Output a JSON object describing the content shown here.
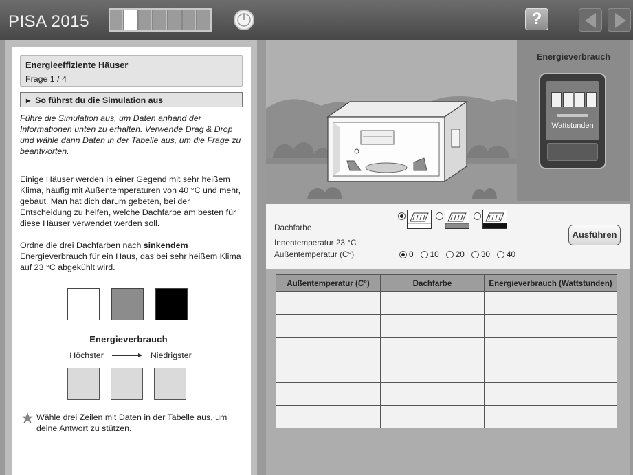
{
  "app": {
    "title": "PISA 2015"
  },
  "progress": {
    "total": 7,
    "current": 2
  },
  "left": {
    "unit_title": "Energieeffiziente Häuser",
    "question_counter": "Frage 1 / 4",
    "howto_label": "So führst du die Simulation aus",
    "intro_italic": "Führe die Simulation aus, um Daten anhand der Informationen unten zu erhalten. Verwende Drag & Drop und wähle dann Daten in der Tabelle aus, um die Frage zu beantworten.",
    "context": "Einige Häuser werden in einer Gegend mit sehr heißem Klima, häufig mit Außentemperaturen von 40 °C und mehr, gebaut. Man hat dich darum gebeten, bei der Entscheidung zu helfen, welche Dachfarbe am besten für diese Häuser verwendet werden soll.",
    "task_before": "Ordne die drei Dachfarben nach ",
    "task_bold": "sinkendem",
    "task_after": " Energieverbrauch für ein Haus, das bei sehr heißem Klima auf 23 °C abgekühlt wird.",
    "color_squares": [
      "#ffffff",
      "#8c8c8c",
      "#000000"
    ],
    "ranking_title": "Energieverbrauch",
    "ranking_high": "Höchster",
    "ranking_low": "Niedrigster",
    "note": "Wähle drei Zeilen mit Daten in der Tabelle aus, um deine Antwort zu stützen."
  },
  "meter": {
    "title": "Energieverbrauch",
    "unit": "Wattstunden"
  },
  "controls": {
    "roof_label": "Dachfarbe",
    "inside_temp": "Innentemperatur 23 °C",
    "outside_label": "Außentemperatur (C°)",
    "roof_colors": [
      "#ffffff",
      "#8c8c8c",
      "#111111"
    ],
    "roof_selected": 0,
    "temps": [
      "0",
      "10",
      "20",
      "30",
      "40"
    ],
    "temp_selected": 0,
    "run_label": "Ausführen"
  },
  "table": {
    "headers": [
      "Außentemperatur (C°)",
      "Dachfarbe",
      "Energieverbrauch (Wattstunden)"
    ],
    "rows": [
      [
        "",
        "",
        ""
      ],
      [
        "",
        "",
        ""
      ],
      [
        "",
        "",
        ""
      ],
      [
        "",
        "",
        ""
      ],
      [
        "",
        "",
        ""
      ],
      [
        "",
        "",
        ""
      ]
    ]
  }
}
